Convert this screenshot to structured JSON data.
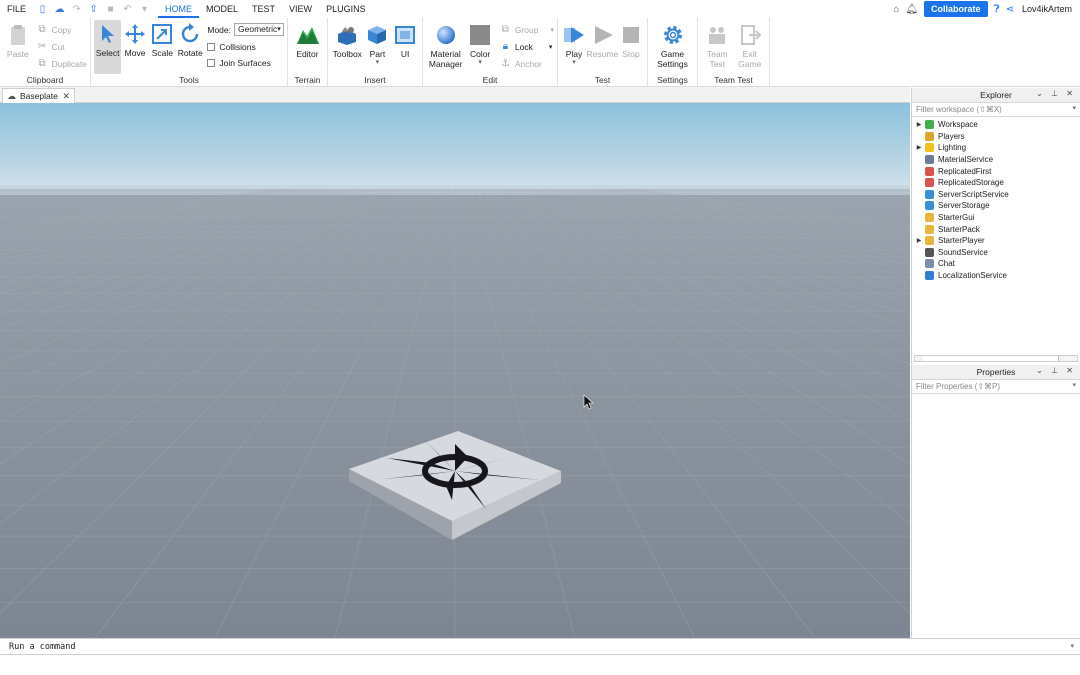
{
  "menu": {
    "file": "FILE",
    "tabs": [
      "HOME",
      "MODEL",
      "TEST",
      "VIEW",
      "PLUGINS"
    ],
    "active_tab": "HOME",
    "collaborate": "Collaborate",
    "username": "Lov4ikArtem"
  },
  "ribbon": {
    "clipboard": {
      "label": "Clipboard",
      "paste": "Paste",
      "copy": "Copy",
      "cut": "Cut",
      "duplicate": "Duplicate"
    },
    "tools": {
      "label": "Tools",
      "select": "Select",
      "move": "Move",
      "scale": "Scale",
      "rotate": "Rotate",
      "mode_label": "Mode:",
      "mode_value": "Geometric",
      "collisions": "Collisions",
      "join_surfaces": "Join Surfaces"
    },
    "terrain": {
      "label": "Terrain",
      "editor": "Editor"
    },
    "insert": {
      "label": "Insert",
      "toolbox": "Toolbox",
      "part": "Part",
      "ui": "UI"
    },
    "edit": {
      "label": "Edit",
      "material_manager_1": "Material",
      "material_manager_2": "Manager",
      "color": "Color",
      "group": "Group",
      "lock": "Lock",
      "anchor": "Anchor"
    },
    "test": {
      "label": "Test",
      "play": "Play",
      "resume": "Resume",
      "stop": "Stop"
    },
    "settings": {
      "label": "Settings",
      "game_settings_1": "Game",
      "game_settings_2": "Settings"
    },
    "team_test": {
      "label": "Team Test",
      "team_test_1": "Team",
      "team_test_2": "Test",
      "exit_game_1": "Exit",
      "exit_game_2": "Game"
    }
  },
  "document_tab": {
    "title": "Baseplate"
  },
  "explorer": {
    "title": "Explorer",
    "filter_placeholder": "Filter workspace (⇧⌘X)",
    "items": [
      {
        "label": "Workspace",
        "expandable": true,
        "icon": "workspace-icon",
        "color": "#3fae4f"
      },
      {
        "label": "Players",
        "expandable": false,
        "icon": "players-icon",
        "color": "#d9a52b"
      },
      {
        "label": "Lighting",
        "expandable": true,
        "icon": "lighting-icon",
        "color": "#f2c21a"
      },
      {
        "label": "MaterialService",
        "expandable": false,
        "icon": "material-service-icon",
        "color": "#6b7c93"
      },
      {
        "label": "ReplicatedFirst",
        "expandable": false,
        "icon": "replicated-first-icon",
        "color": "#d9534f"
      },
      {
        "label": "ReplicatedStorage",
        "expandable": false,
        "icon": "replicated-storage-icon",
        "color": "#d9534f"
      },
      {
        "label": "ServerScriptService",
        "expandable": false,
        "icon": "server-script-service-icon",
        "color": "#3a8fd6"
      },
      {
        "label": "ServerStorage",
        "expandable": false,
        "icon": "server-storage-icon",
        "color": "#3a8fd6"
      },
      {
        "label": "StarterGui",
        "expandable": false,
        "icon": "starter-gui-icon",
        "color": "#e6b73a"
      },
      {
        "label": "StarterPack",
        "expandable": false,
        "icon": "starter-pack-icon",
        "color": "#e6b73a"
      },
      {
        "label": "StarterPlayer",
        "expandable": true,
        "icon": "starter-player-icon",
        "color": "#e6b73a"
      },
      {
        "label": "SoundService",
        "expandable": false,
        "icon": "sound-service-icon",
        "color": "#555555"
      },
      {
        "label": "Chat",
        "expandable": false,
        "icon": "chat-icon",
        "color": "#7d8fa6"
      },
      {
        "label": "LocalizationService",
        "expandable": false,
        "icon": "localization-service-icon",
        "color": "#2f7fd1"
      }
    ]
  },
  "properties": {
    "title": "Properties",
    "filter_placeholder": "Filter Properties (⇧⌘P)"
  },
  "command_bar": {
    "placeholder": "Run a command"
  },
  "colors": {
    "accent": "#1a73e8",
    "sky_top": "#8ec3de",
    "horizon": "#c9dbe6",
    "ground": "#8a939e"
  }
}
